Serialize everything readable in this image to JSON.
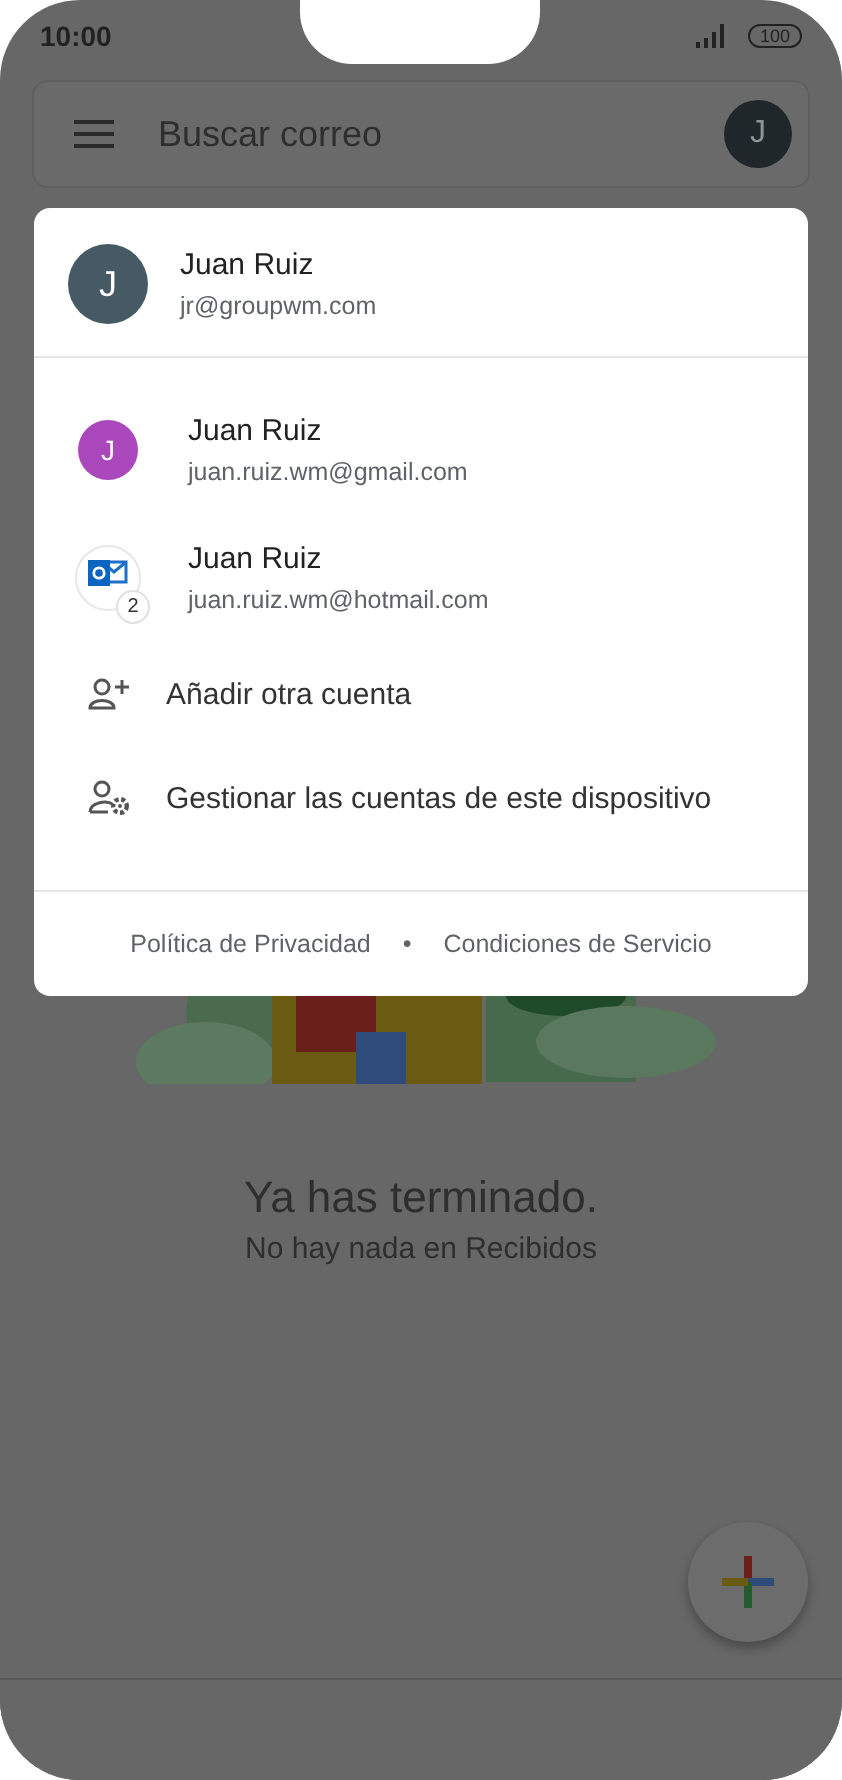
{
  "status_bar": {
    "time": "10:00",
    "battery": "100"
  },
  "search_bar": {
    "placeholder": "Buscar correo",
    "avatar_letter": "J"
  },
  "empty_state": {
    "title": "Ya has terminado.",
    "subtitle": "No hay nada en Recibidos"
  },
  "account_menu": {
    "current": {
      "avatar_letter": "J",
      "name": "Juan Ruiz",
      "email": "jr@groupwm.com"
    },
    "accounts": [
      {
        "kind": "letter",
        "avatar_letter": "J",
        "color": "#ab47bc",
        "name": "Juan Ruiz",
        "email": "juan.ruiz.wm@gmail.com"
      },
      {
        "kind": "outlook",
        "badge": "2",
        "name": "Juan Ruiz",
        "email": "juan.ruiz.wm@hotmail.com"
      }
    ],
    "actions": [
      {
        "kind": "add",
        "label": "Añadir otra cuenta"
      },
      {
        "kind": "manage",
        "label": "Gestionar las cuentas de este dispositivo"
      }
    ],
    "footer_links": [
      "Política de Privacidad",
      "Condiciones de Servicio"
    ],
    "footer_separator": "•"
  }
}
